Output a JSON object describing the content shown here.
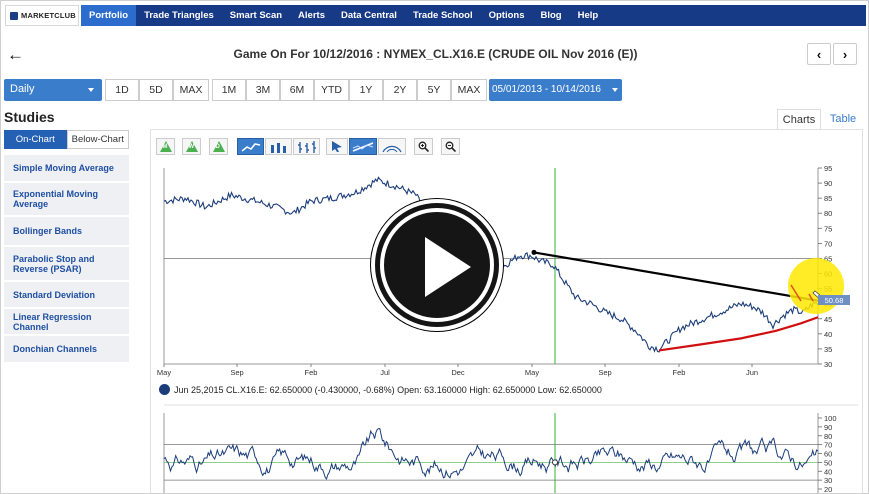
{
  "nav": {
    "logo": "MARKETCLUB",
    "items": [
      "Portfolio",
      "Trade Triangles",
      "Smart Scan",
      "Alerts",
      "Data Central",
      "Trade School",
      "Options",
      "Blog",
      "Help"
    ],
    "active_index": 0
  },
  "header": {
    "title": "Game On For 10/12/2016 : NYMEX_CL.X16.E (CRUDE OIL Nov 2016 (E))",
    "back_icon": "arrow-left-icon",
    "prev_icon": "chevron-left-icon",
    "next_icon": "chevron-right-icon"
  },
  "toolbar": {
    "period": "Daily",
    "group1": [
      "1D",
      "5D",
      "MAX"
    ],
    "group2": [
      "1M",
      "3M",
      "6M",
      "YTD",
      "1Y",
      "2Y",
      "5Y",
      "MAX"
    ],
    "date_range": "05/01/2013 - 10/14/2016"
  },
  "studies": {
    "title": "Studies",
    "tabs": [
      "On-Chart",
      "Below-Chart"
    ],
    "items": [
      "Simple Moving Average",
      "Exponential Moving Average",
      "Bollinger Bands",
      "Parabolic Stop and Reverse (PSAR)",
      "Standard Deviation",
      "Linear Regression Channel",
      "Donchian Channels"
    ]
  },
  "chart_tabs": [
    "Charts",
    "Table"
  ],
  "chart_tools": {
    "triangles": [
      "M",
      "W",
      "D"
    ]
  },
  "chart_data": {
    "type": "line",
    "x_ticks": [
      "May",
      "Sep",
      "Feb",
      "Jul",
      "Dec",
      "May",
      "Sep",
      "Feb",
      "Jun"
    ],
    "y_ticks": [
      30,
      35,
      40,
      45,
      50,
      55,
      60,
      65,
      70,
      75,
      80,
      85,
      90,
      95
    ],
    "ylim": [
      30,
      95
    ],
    "last_price_label": "50.68",
    "info_text": "Jun 25,2015 CL.X16.E: 62.650000 (-0.430000, -0.68%) Open: 63.160000 High: 62.650000 Low: 62.650000",
    "lower_ticks": [
      100,
      90,
      80,
      70,
      60,
      50,
      40,
      30,
      20
    ],
    "lower_ylim": [
      20,
      100
    ],
    "colors": {
      "price": "#1b3d7a",
      "trend": "#000000",
      "support": "#d01010",
      "cursor": "#36b336",
      "highlight": "#ffe800"
    }
  }
}
